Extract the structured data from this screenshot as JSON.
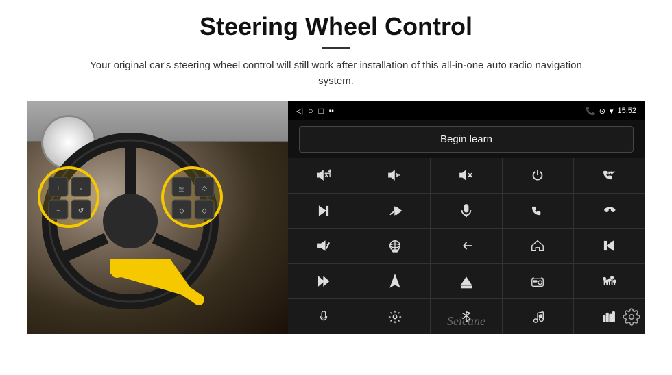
{
  "page": {
    "title": "Steering Wheel Control",
    "subtitle": "Your original car's steering wheel control will still work after installation of this all-in-one auto radio navigation system.",
    "divider": "—"
  },
  "status_bar": {
    "back_icon": "◁",
    "home_icon": "□",
    "recent_icon": "☐",
    "signal_icon": "▪▪",
    "phone_icon": "📞",
    "location_icon": "⊙",
    "wifi_icon": "▾",
    "time": "15:52"
  },
  "begin_learn": {
    "label": "Begin learn"
  },
  "seicane": {
    "watermark": "Seicane"
  },
  "grid_icons": [
    {
      "id": "vol-up",
      "symbol": "vol+"
    },
    {
      "id": "vol-down",
      "symbol": "vol-"
    },
    {
      "id": "mute",
      "symbol": "mute"
    },
    {
      "id": "power",
      "symbol": "pwr"
    },
    {
      "id": "prev-track-phone",
      "symbol": "prev-ph"
    },
    {
      "id": "next-track",
      "symbol": "next"
    },
    {
      "id": "fast-forward-skip",
      "symbol": "ff"
    },
    {
      "id": "mic",
      "symbol": "mic"
    },
    {
      "id": "phone",
      "symbol": "phone"
    },
    {
      "id": "hang-up",
      "symbol": "hangup"
    },
    {
      "id": "horn",
      "symbol": "horn"
    },
    {
      "id": "360-view",
      "symbol": "360"
    },
    {
      "id": "back-nav",
      "symbol": "back"
    },
    {
      "id": "home-nav",
      "symbol": "home"
    },
    {
      "id": "prev-media",
      "symbol": "prev-m"
    },
    {
      "id": "fast-forward2",
      "symbol": "ff2"
    },
    {
      "id": "navigation",
      "symbol": "nav"
    },
    {
      "id": "eject",
      "symbol": "eject"
    },
    {
      "id": "radio",
      "symbol": "radio"
    },
    {
      "id": "equalizer",
      "symbol": "eq"
    },
    {
      "id": "microphone2",
      "symbol": "mic2"
    },
    {
      "id": "settings2",
      "symbol": "set2"
    },
    {
      "id": "bluetooth",
      "symbol": "bt"
    },
    {
      "id": "music-settings",
      "symbol": "music"
    },
    {
      "id": "sound-bars",
      "symbol": "sound"
    }
  ]
}
